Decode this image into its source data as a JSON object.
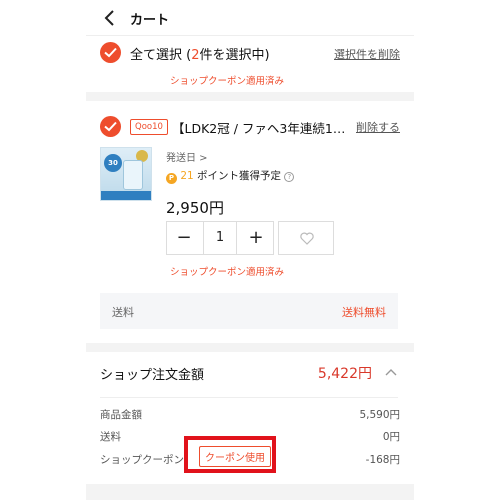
{
  "header": {
    "title": "カート",
    "back_icon": "chevron-left-icon"
  },
  "select_all": {
    "prefix": "全て選択 (",
    "count": "2",
    "suffix": "件を選択中)",
    "delete_selected": "選択件を削除"
  },
  "shop_coupon_note_top": "ショップクーポン適用済み",
  "item": {
    "shop_badge": "Qoo10",
    "title": "【LDK2冠 / ファヘ3年連続1位...",
    "delete": "削除する",
    "ship_date": "発送日 >",
    "points_icon": "P",
    "points_value": "21",
    "points_label": " ポイント獲得予定 ",
    "help": "?",
    "price": "2,950円",
    "qty": "1",
    "minus": "−",
    "plus": "+",
    "coupon_note": "ショップクーポン適用済み",
    "image_badge": "30"
  },
  "shipping": {
    "label": "送料",
    "value": "送料無料"
  },
  "order": {
    "label": "ショップ注文金額",
    "total": "5,422円",
    "rows": [
      {
        "label": "商品金額",
        "value": "5,590円"
      },
      {
        "label": "送料",
        "value": "0円"
      },
      {
        "label": "ショップクーポン",
        "value": "-168円"
      }
    ],
    "coupon_button": "クーポン使用"
  },
  "colors": {
    "accent": "#ee4d2d",
    "highlight": "#e1121b",
    "total": "#d9382a"
  }
}
